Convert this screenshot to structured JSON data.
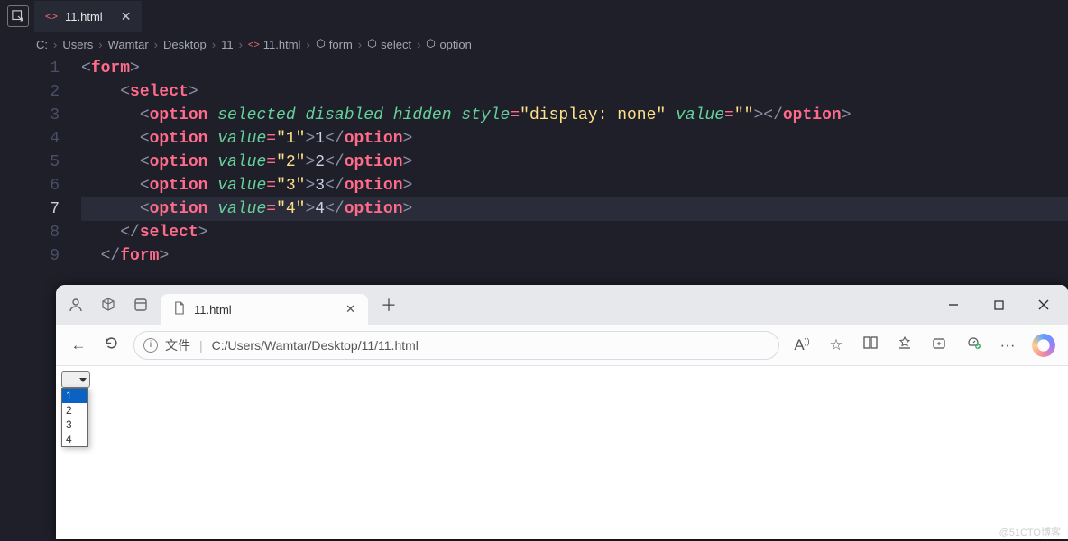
{
  "editor": {
    "tab_file": "11.html",
    "breadcrumb": [
      "C:",
      "Users",
      "Wamtar",
      "Desktop",
      "11",
      "11.html",
      "form",
      "select",
      "option"
    ],
    "current_line": 7,
    "code_lines": [
      {
        "n": 1,
        "indent": 0,
        "tag": "form",
        "attrs": [],
        "text": null,
        "close": false
      },
      {
        "n": 2,
        "indent": 2,
        "tag": "select",
        "attrs": [],
        "text": null,
        "close": false
      },
      {
        "n": 3,
        "indent": 3,
        "tag": "option",
        "attrs": [
          {
            "name": "selected"
          },
          {
            "name": "disabled"
          },
          {
            "name": "hidden"
          },
          {
            "name": "style",
            "value": "display: none"
          },
          {
            "name": "value",
            "value": ""
          }
        ],
        "text": "",
        "close": true
      },
      {
        "n": 4,
        "indent": 3,
        "tag": "option",
        "attrs": [
          {
            "name": "value",
            "value": "1"
          }
        ],
        "text": "1",
        "close": true
      },
      {
        "n": 5,
        "indent": 3,
        "tag": "option",
        "attrs": [
          {
            "name": "value",
            "value": "2"
          }
        ],
        "text": "2",
        "close": true
      },
      {
        "n": 6,
        "indent": 3,
        "tag": "option",
        "attrs": [
          {
            "name": "value",
            "value": "3"
          }
        ],
        "text": "3",
        "close": true
      },
      {
        "n": 7,
        "indent": 3,
        "tag": "option",
        "attrs": [
          {
            "name": "value",
            "value": "4"
          }
        ],
        "text": "4",
        "close": true
      },
      {
        "n": 8,
        "indent": 2,
        "tag": "select",
        "attrs": [],
        "text": null,
        "close_only": true
      },
      {
        "n": 9,
        "indent": 1,
        "tag": "form",
        "attrs": [],
        "text": null,
        "close_only": true
      }
    ]
  },
  "browser": {
    "tab_title": "11.html",
    "address_prefix": "文件",
    "address_path": "C:/Users/Wamtar/Desktop/11/11.html",
    "select_options": [
      "1",
      "2",
      "3",
      "4"
    ],
    "select_highlight": 0
  },
  "watermark": "@51CTO博客"
}
